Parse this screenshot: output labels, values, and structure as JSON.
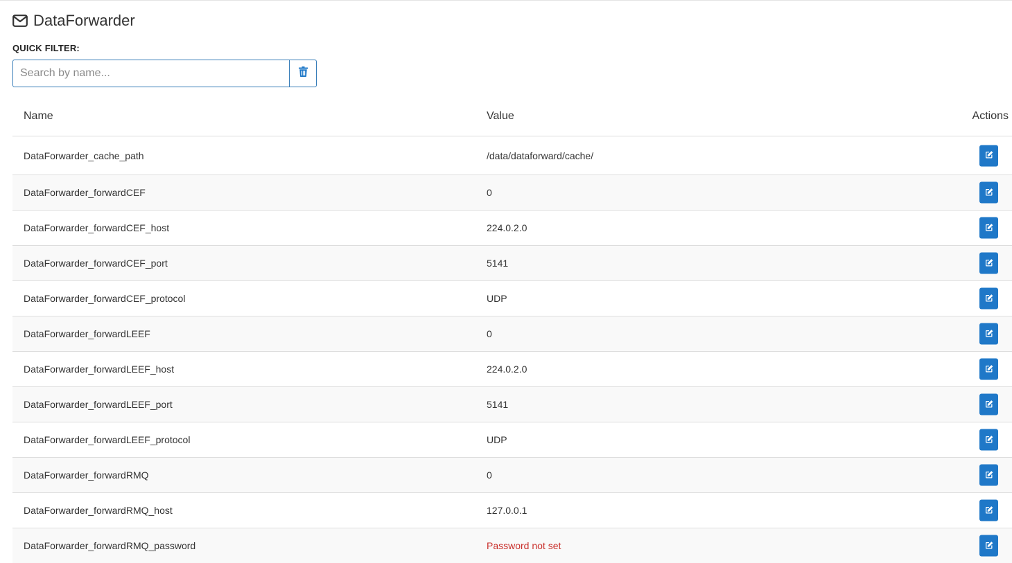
{
  "header": {
    "title": "DataForwarder",
    "icon": "envelope-icon"
  },
  "filter": {
    "label": "QUICK FILTER:",
    "placeholder": "Search by name...",
    "value": "",
    "clear_icon": "trash-icon"
  },
  "table": {
    "columns": [
      "Name",
      "Value",
      "Actions"
    ],
    "rows": [
      {
        "name": "DataForwarder_cache_path",
        "value": "/data/dataforward/cache/"
      },
      {
        "name": "DataForwarder_forwardCEF",
        "value": "0"
      },
      {
        "name": "DataForwarder_forwardCEF_host",
        "value": "224.0.2.0"
      },
      {
        "name": "DataForwarder_forwardCEF_port",
        "value": "5141"
      },
      {
        "name": "DataForwarder_forwardCEF_protocol",
        "value": "UDP"
      },
      {
        "name": "DataForwarder_forwardLEEF",
        "value": "0"
      },
      {
        "name": "DataForwarder_forwardLEEF_host",
        "value": "224.0.2.0"
      },
      {
        "name": "DataForwarder_forwardLEEF_port",
        "value": "5141"
      },
      {
        "name": "DataForwarder_forwardLEEF_protocol",
        "value": "UDP"
      },
      {
        "name": "DataForwarder_forwardRMQ",
        "value": "0"
      },
      {
        "name": "DataForwarder_forwardRMQ_host",
        "value": "127.0.0.1"
      },
      {
        "name": "DataForwarder_forwardRMQ_password",
        "value": "Password not set",
        "warning": true
      }
    ],
    "action_icon": "edit-icon"
  },
  "colors": {
    "accent": "#1f78c8",
    "border": "#337ab7",
    "warning_text": "#c9302c",
    "stripe": "#f9f9f9"
  }
}
